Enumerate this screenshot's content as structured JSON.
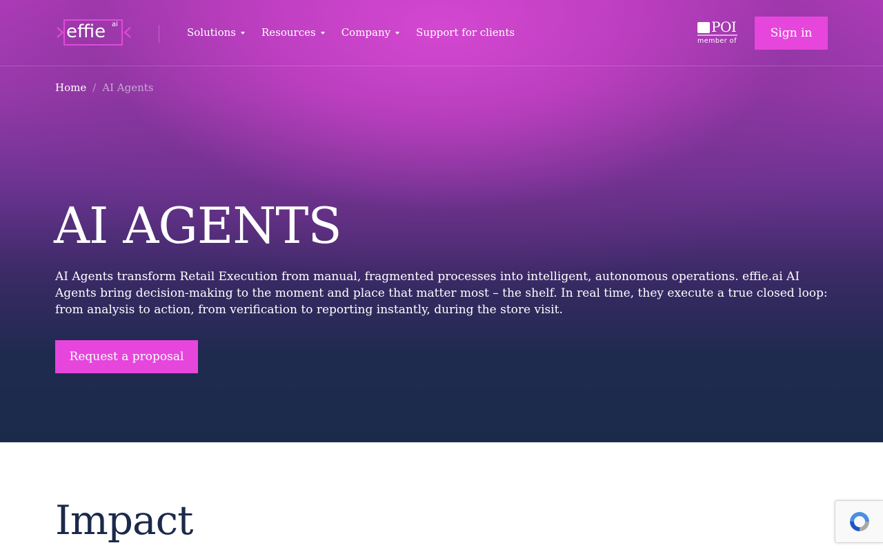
{
  "logo": {
    "wordmark": "effie",
    "superscript": "ai"
  },
  "nav": {
    "items": [
      {
        "label": "Solutions",
        "has_dropdown": true
      },
      {
        "label": "Resources",
        "has_dropdown": true
      },
      {
        "label": "Company",
        "has_dropdown": true
      },
      {
        "label": "Support for clients",
        "has_dropdown": false
      }
    ]
  },
  "badge": {
    "text": "POI",
    "caption": "member of"
  },
  "header": {
    "signin_label": "Sign in"
  },
  "breadcrumb": {
    "home": "Home",
    "separator": "/",
    "current": "AI Agents"
  },
  "hero": {
    "title": "AI AGENTS",
    "description": "AI Agents transform Retail Execution from manual, fragmented processes into intelligent, autonomous operations. effie.ai AI Agents bring decision-making to the moment and place that matter most – the shelf. In real time, they execute a true closed loop: from analysis to action, from verification to reporting instantly, during the store visit.",
    "cta_label": "Request a proposal"
  },
  "section": {
    "impact_title": "Impact"
  },
  "colors": {
    "accent": "#e646dc",
    "heading_dark": "#1b2a4a",
    "hero_bottom": "#1b2a4b",
    "hero_top": "#c043c6"
  },
  "icons": {
    "recaptcha": "recaptcha-icon",
    "logo_chevrons": "chevron-icon"
  }
}
